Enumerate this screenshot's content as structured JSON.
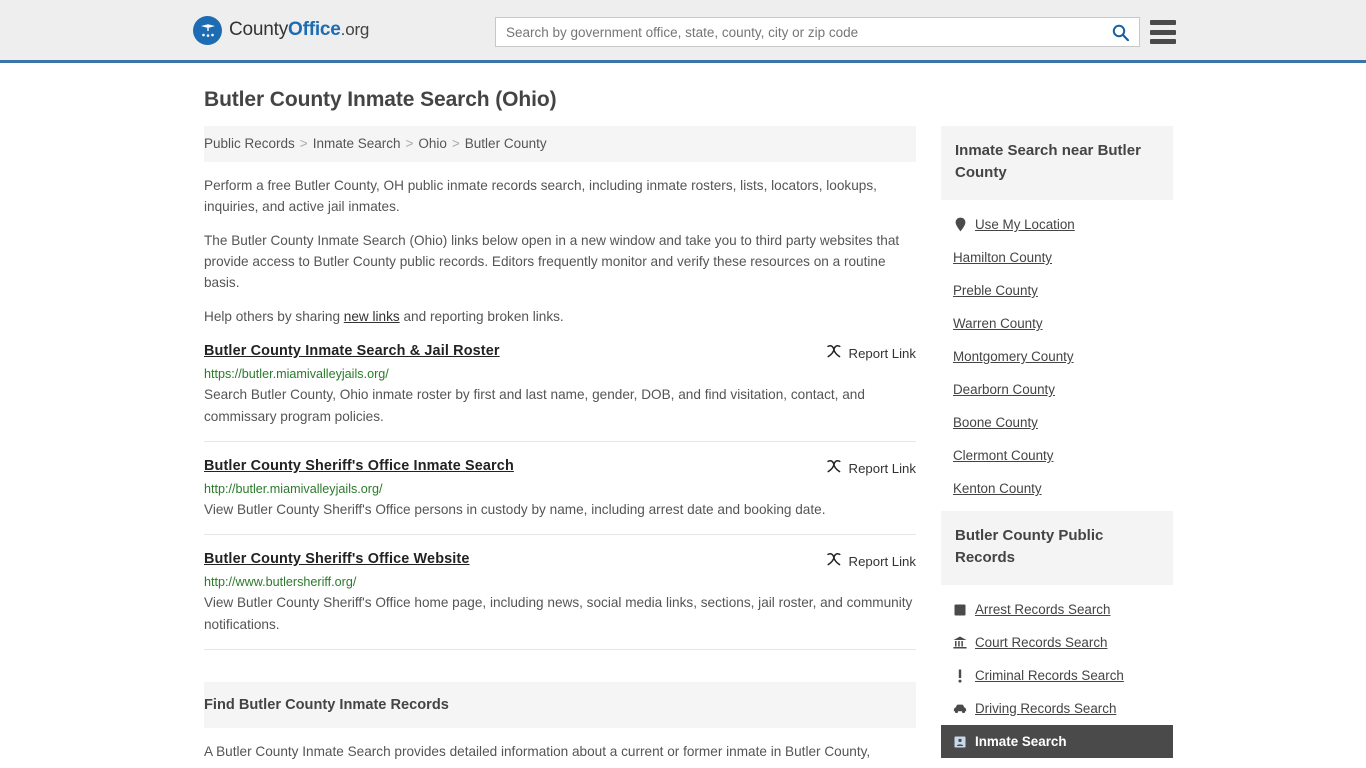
{
  "header": {
    "logo": {
      "icon": "eagle-seal-icon",
      "text_part1": "County",
      "text_part2": "Office",
      "text_part3": ".org"
    },
    "search": {
      "placeholder": "Search by government office, state, county, city or zip code",
      "value": "",
      "icon": "search-icon"
    },
    "menu_icon": "hamburger-menu-icon",
    "accent_color": "#3a74a8",
    "background_color": "#eeeeee"
  },
  "page": {
    "title": "Butler County Inmate Search (Ohio)"
  },
  "breadcrumb": {
    "separator": ">",
    "items": [
      {
        "label": "Public Records"
      },
      {
        "label": "Inmate Search"
      },
      {
        "label": "Ohio"
      },
      {
        "label": "Butler County"
      }
    ]
  },
  "intro": {
    "p1": "Perform a free Butler County, OH public inmate records search, including inmate rosters, lists, locators, lookups, inquiries, and active jail inmates.",
    "p2": "The Butler County Inmate Search (Ohio) links below open in a new window and take you to third party websites that provide access to Butler County public records. Editors frequently monitor and verify these resources on a routine basis.",
    "p3_before": "Help others by sharing ",
    "p3_link": "new links",
    "p3_after": " and reporting broken links."
  },
  "report_link_label": "Report Link",
  "report_link_icon": "broken-link-icon",
  "results": [
    {
      "title": "Butler County Inmate Search & Jail Roster",
      "url": "https://butler.miamivalleyjails.org/",
      "description": "Search Butler County, Ohio inmate roster by first and last name, gender, DOB, and find visitation, contact, and commissary program policies."
    },
    {
      "title": "Butler County Sheriff's Office Inmate Search",
      "url": "http://butler.miamivalleyjails.org/",
      "description": "View Butler County Sheriff's Office persons in custody by name, including arrest date and booking date."
    },
    {
      "title": "Butler County Sheriff's Office Website",
      "url": "http://www.butlersheriff.org/",
      "description": "View Butler County Sheriff's Office home page, including news, social media links, sections, jail roster, and community notifications."
    }
  ],
  "find_section": {
    "title": "Find Butler County Inmate Records",
    "body": "A Butler County Inmate Search provides detailed information about a current or former inmate in Butler County,"
  },
  "sidebar": {
    "nearby": {
      "title": "Inmate Search near Butler County",
      "items": [
        {
          "label": "Use My Location",
          "icon": "map-pin-icon",
          "active": false
        },
        {
          "label": "Hamilton County",
          "icon": "",
          "active": false
        },
        {
          "label": "Preble County",
          "icon": "",
          "active": false
        },
        {
          "label": "Warren County",
          "icon": "",
          "active": false
        },
        {
          "label": "Montgomery County",
          "icon": "",
          "active": false
        },
        {
          "label": "Dearborn County",
          "icon": "",
          "active": false
        },
        {
          "label": "Boone County",
          "icon": "",
          "active": false
        },
        {
          "label": "Clermont County",
          "icon": "",
          "active": false
        },
        {
          "label": "Kenton County",
          "icon": "",
          "active": false
        }
      ]
    },
    "public_records": {
      "title": "Butler County Public Records",
      "items": [
        {
          "label": "Arrest Records Search",
          "icon": "fingerprint-square-icon",
          "active": false
        },
        {
          "label": "Court Records Search",
          "icon": "courthouse-icon",
          "active": false
        },
        {
          "label": "Criminal Records Search",
          "icon": "exclamation-icon",
          "active": false
        },
        {
          "label": "Driving Records Search",
          "icon": "car-icon",
          "active": false
        },
        {
          "label": "Inmate Search",
          "icon": "inmate-card-icon",
          "active": true
        }
      ]
    }
  }
}
